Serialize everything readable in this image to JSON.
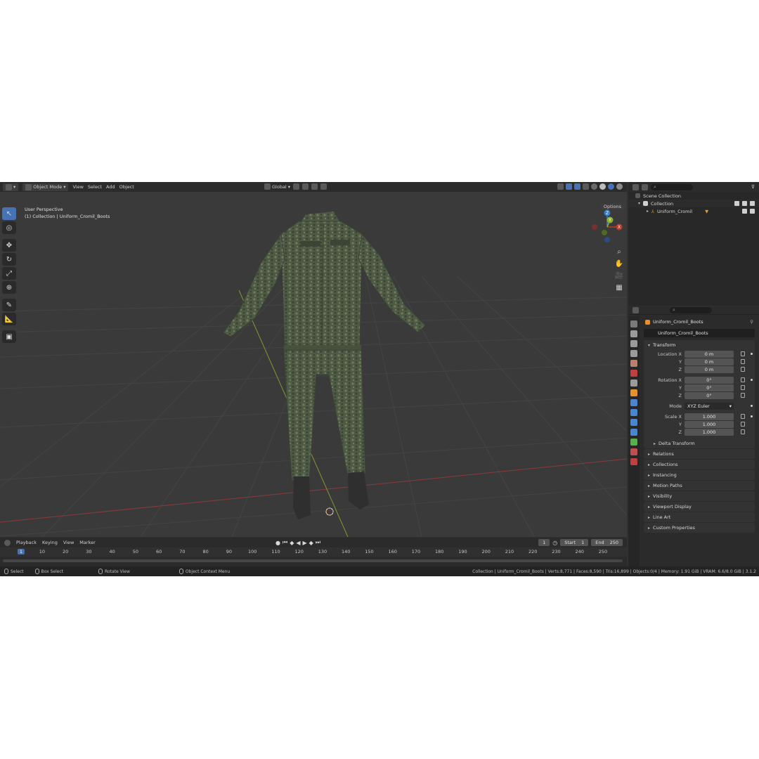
{
  "header": {
    "mode": "Object Mode",
    "menus": [
      "View",
      "Select",
      "Add",
      "Object"
    ],
    "orientation": "Global"
  },
  "viewport": {
    "perspective": "User Perspective",
    "collection_info": "(1) Collection | Uniform_Cromil_Boots",
    "options": "Options",
    "gizmo_axes": [
      "X",
      "Y",
      "Z"
    ]
  },
  "outliner": {
    "scene_collection": "Scene Collection",
    "collection": "Collection",
    "object": "Uniform_Cromil"
  },
  "properties": {
    "object_title": "Uniform_Cromil_Boots",
    "object_name": "Uniform_Cromil_Boots",
    "transform_title": "Transform",
    "location": {
      "label_x": "Location X",
      "label_y": "Y",
      "label_z": "Z",
      "x": "0 m",
      "y": "0 m",
      "z": "0 m"
    },
    "rotation": {
      "label_x": "Rotation X",
      "label_y": "Y",
      "label_z": "Z",
      "x": "0°",
      "y": "0°",
      "z": "0°"
    },
    "mode": {
      "label": "Mode",
      "value": "XYZ Euler"
    },
    "scale": {
      "label_x": "Scale X",
      "label_y": "Y",
      "label_z": "Z",
      "x": "1.000",
      "y": "1.000",
      "z": "1.000"
    },
    "delta_transform": "Delta Transform",
    "panels": [
      "Relations",
      "Collections",
      "Instancing",
      "Motion Paths",
      "Visibility",
      "Viewport Display",
      "Line Art",
      "Custom Properties"
    ]
  },
  "timeline": {
    "menus": [
      "Playback",
      "Keying",
      "View",
      "Marker"
    ],
    "current_frame": "1",
    "start_label": "Start",
    "start": "1",
    "end_label": "End",
    "end": "250",
    "ruler": [
      "1",
      "10",
      "20",
      "30",
      "40",
      "50",
      "60",
      "70",
      "80",
      "90",
      "100",
      "110",
      "120",
      "130",
      "140",
      "150",
      "160",
      "170",
      "180",
      "190",
      "200",
      "210",
      "220",
      "230",
      "240",
      "250"
    ]
  },
  "status": {
    "select": "Select",
    "box_select": "Box Select",
    "rotate_view": "Rotate View",
    "context_menu": "Object Context Menu",
    "stats": "Collection | Uniform_Cromil_Boots | Verts:8,771 | Faces:8,590 | Tris:16,899 | Objects:0/4 | Memory: 1.91 GiB | VRAM: 6.6/8.0 GiB | 3.1.2"
  },
  "colors": {
    "accent": "#4772b3",
    "x_axis": "#c0392b",
    "y_axis": "#8db32d",
    "z_axis": "#2f7fd1"
  }
}
